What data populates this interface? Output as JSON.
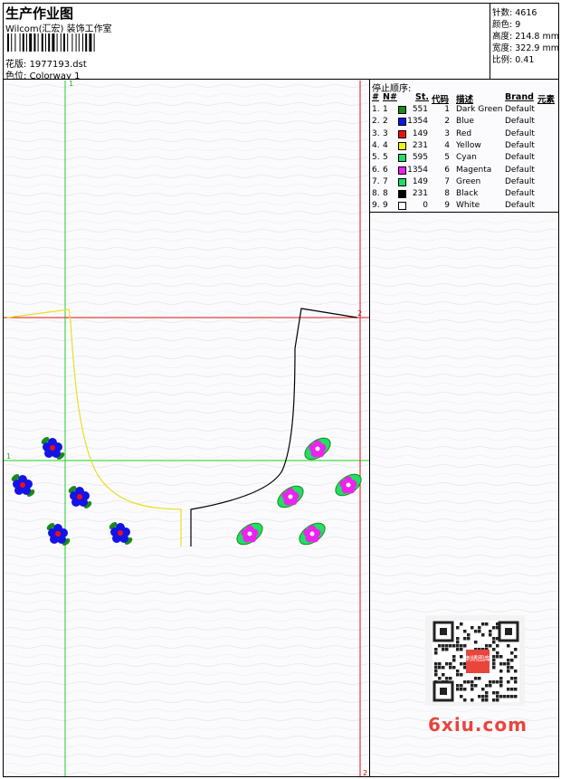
{
  "header": {
    "title": "生产作业图",
    "subtitle": "Wilcom(汇宏) 装饰工作室",
    "design_label": "花版:",
    "design_value": "1977193.dst",
    "colorway_label": "色位:",
    "colorway_value": "Colorway 1"
  },
  "stats": [
    {
      "label": "针数:",
      "value": "4616"
    },
    {
      "label": "颜色:",
      "value": "9"
    },
    {
      "label": "高度:",
      "value": "214.8 mm"
    },
    {
      "label": "宽度:",
      "value": "322.9 mm"
    },
    {
      "label": "比例:",
      "value": "0.41"
    }
  ],
  "panel": {
    "title": "停止顺序:",
    "columns": [
      "#",
      "N#",
      "St.",
      "代码",
      "描述",
      "Brand",
      "元素"
    ],
    "rows": [
      {
        "num": "1.",
        "n": "1",
        "st": "551",
        "code": "1",
        "desc": "Dark Green",
        "brand": "Default",
        "color": "#1a8a1a"
      },
      {
        "num": "2.",
        "n": "2",
        "st": "1354",
        "code": "2",
        "desc": "Blue",
        "brand": "Default",
        "color": "#1414e6"
      },
      {
        "num": "3.",
        "n": "3",
        "st": "149",
        "code": "3",
        "desc": "Red",
        "brand": "Default",
        "color": "#ee1111"
      },
      {
        "num": "4.",
        "n": "4",
        "st": "231",
        "code": "4",
        "desc": "Yellow",
        "brand": "Default",
        "color": "#f3f312"
      },
      {
        "num": "5.",
        "n": "5",
        "st": "595",
        "code": "5",
        "desc": "Cyan",
        "brand": "Default",
        "color": "#22dd66"
      },
      {
        "num": "6.",
        "n": "6",
        "st": "1354",
        "code": "6",
        "desc": "Magenta",
        "brand": "Default",
        "color": "#ee22ee"
      },
      {
        "num": "7.",
        "n": "7",
        "st": "149",
        "code": "7",
        "desc": "Green",
        "brand": "Default",
        "color": "#22dd66"
      },
      {
        "num": "8.",
        "n": "8",
        "st": "231",
        "code": "8",
        "desc": "Black",
        "brand": "Default",
        "color": "#000000"
      },
      {
        "num": "9.",
        "n": "9",
        "st": "0",
        "code": "9",
        "desc": "White",
        "brand": "Default",
        "color": "#ffffff"
      }
    ]
  },
  "guides": {
    "v1": "1",
    "h1": "1",
    "h2": "2",
    "v2": "2"
  },
  "watermark": {
    "brand": "6xiu.com",
    "badge": "刺绣图库"
  },
  "colors": {
    "guide_green": "#22cc22",
    "guide_red": "#dd1111",
    "outline_yellow": "#e8e020",
    "outline_black": "#000000"
  }
}
